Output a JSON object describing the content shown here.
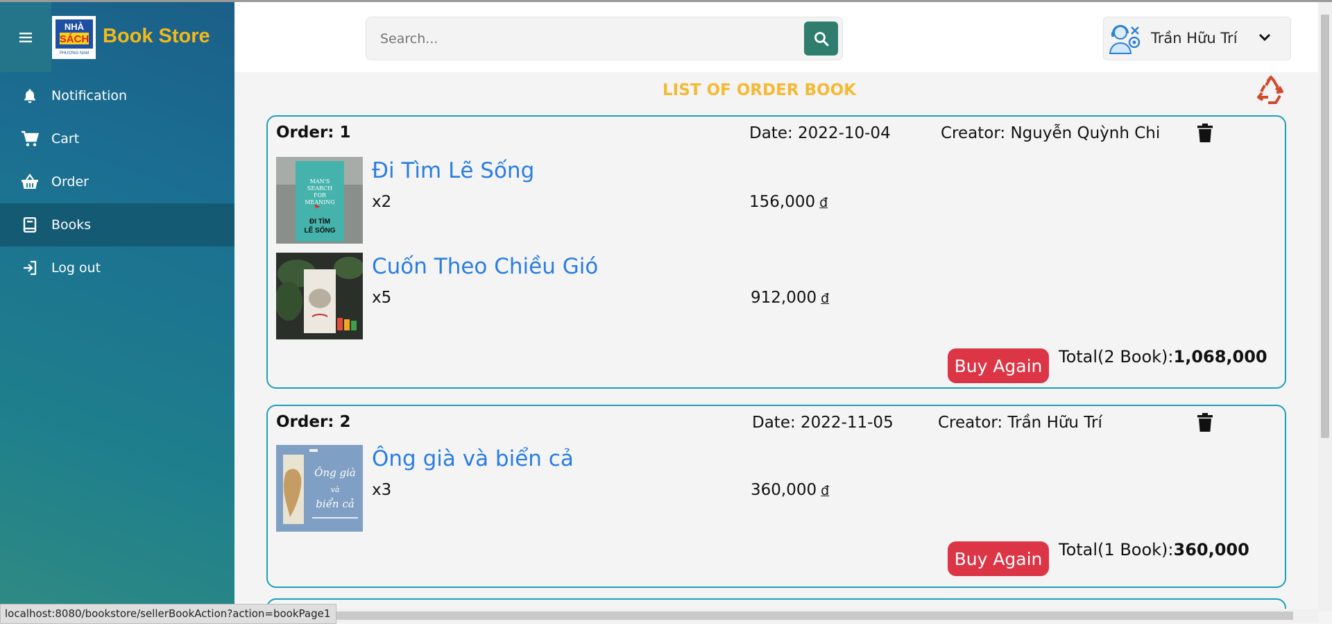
{
  "app": {
    "brand_name": "Book Store",
    "logo_text_top": "NHÀ",
    "logo_text_main": "SÁCH",
    "logo_text_sub": "PHƯƠNG NAM",
    "accent_color": "#f3b81a"
  },
  "sidebar": {
    "menu_icon": "hamburger-icon",
    "items": [
      {
        "label": "Notification",
        "icon": "bell-icon"
      },
      {
        "label": "Cart",
        "icon": "cart-icon"
      },
      {
        "label": "Order",
        "icon": "basket-icon"
      },
      {
        "label": "Books",
        "icon": "book-icon",
        "active": true
      },
      {
        "label": "Log out",
        "icon": "logout-icon"
      }
    ]
  },
  "header": {
    "search_placeholder": "Search...",
    "search_icon": "search-icon",
    "user_name": "Trần Hữu Trí",
    "user_icon": "support-agent-icon",
    "dropdown_icon": "chevron-down-icon"
  },
  "main": {
    "title": "LIST OF ORDER BOOK",
    "recycle_icon": "recycle-icon",
    "orders": [
      {
        "number": "Order: 1",
        "date": "Date: 2022-10-04",
        "creator": "Creator: Nguyễn Quỳnh Chi",
        "items": [
          {
            "title": "Đi Tìm Lẽ Sống",
            "qty": "x2",
            "price": "156,000",
            "currency": "đ",
            "cover_text_top": "MAN'S SEARCH FOR MEANING",
            "cover_text_bottom": "ĐI TÌM LẼ SỐNG"
          },
          {
            "title": "Cuốn Theo Chiều Gió",
            "qty": "x5",
            "price": "912,000",
            "currency": "đ"
          }
        ],
        "buy_again": "Buy Again",
        "total_label": "Total(2 Book):",
        "total_value": "1,068,000"
      },
      {
        "number": "Order: 2",
        "date": "Date: 2022-11-05",
        "creator": "Creator: Trần Hữu Trí",
        "items": [
          {
            "title": "Ông già và biển cả",
            "qty": "x3",
            "price": "360,000",
            "currency": "đ",
            "cover_text": "Ông già và biển cả"
          }
        ],
        "buy_again": "Buy Again",
        "total_label": "Total(1 Book):",
        "total_value": "360,000"
      }
    ]
  },
  "status_bar": {
    "url": "localhost:8080/bookstore/sellerBookAction?action=bookPage1"
  }
}
